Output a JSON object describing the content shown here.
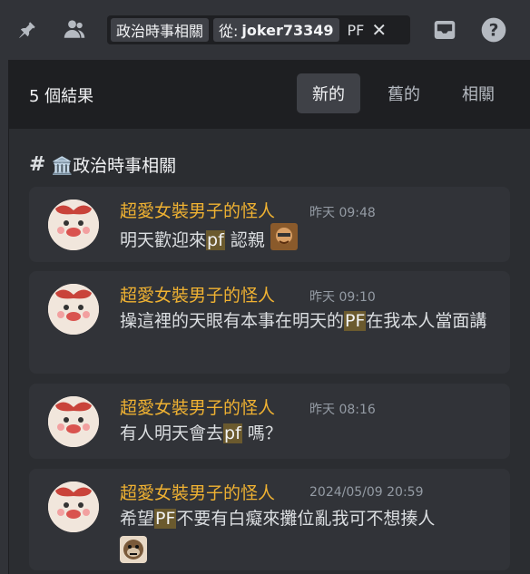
{
  "search": {
    "channel_chip": "政治時事相關",
    "from_key": "從:",
    "from_user": "joker73349",
    "query_text": "PF",
    "clear_icon": "close-icon"
  },
  "header_icons": [
    "pin-icon",
    "members-icon",
    "inbox-icon",
    "help-icon"
  ],
  "results": {
    "count_label": "5 個結果",
    "tabs": [
      {
        "label": "新的",
        "active": true
      },
      {
        "label": "舊的",
        "active": false
      },
      {
        "label": "相關",
        "active": false
      }
    ]
  },
  "channel": {
    "name": "🏛️政治時事相關"
  },
  "messages": [
    {
      "author": "超愛女裝男子的怪人",
      "time": "昨天 09:48",
      "before": "明天歡迎來",
      "highlight": "pf",
      "after": " 認親"
    },
    {
      "author": "超愛女裝男子的怪人",
      "time": "昨天 09:10",
      "before": "操這裡的天眼有本事在明天的",
      "highlight": "PF",
      "after": "在我本人當面講"
    },
    {
      "author": "超愛女裝男子的怪人",
      "time": "昨天 08:16",
      "before": "有人明天會去",
      "highlight": "pf",
      "after": " 嗎？"
    },
    {
      "author": "超愛女裝男子的怪人",
      "time": "2024/05/09 20:59",
      "before": "希望",
      "highlight": "PF",
      "after": "不要有白癡來攤位亂我可不想揍人"
    }
  ],
  "colors": {
    "author": "#f0b232",
    "highlight_bg": "#6b5a2e",
    "panel_bg": "#2b2d31",
    "header_bg": "#1e1f22"
  }
}
